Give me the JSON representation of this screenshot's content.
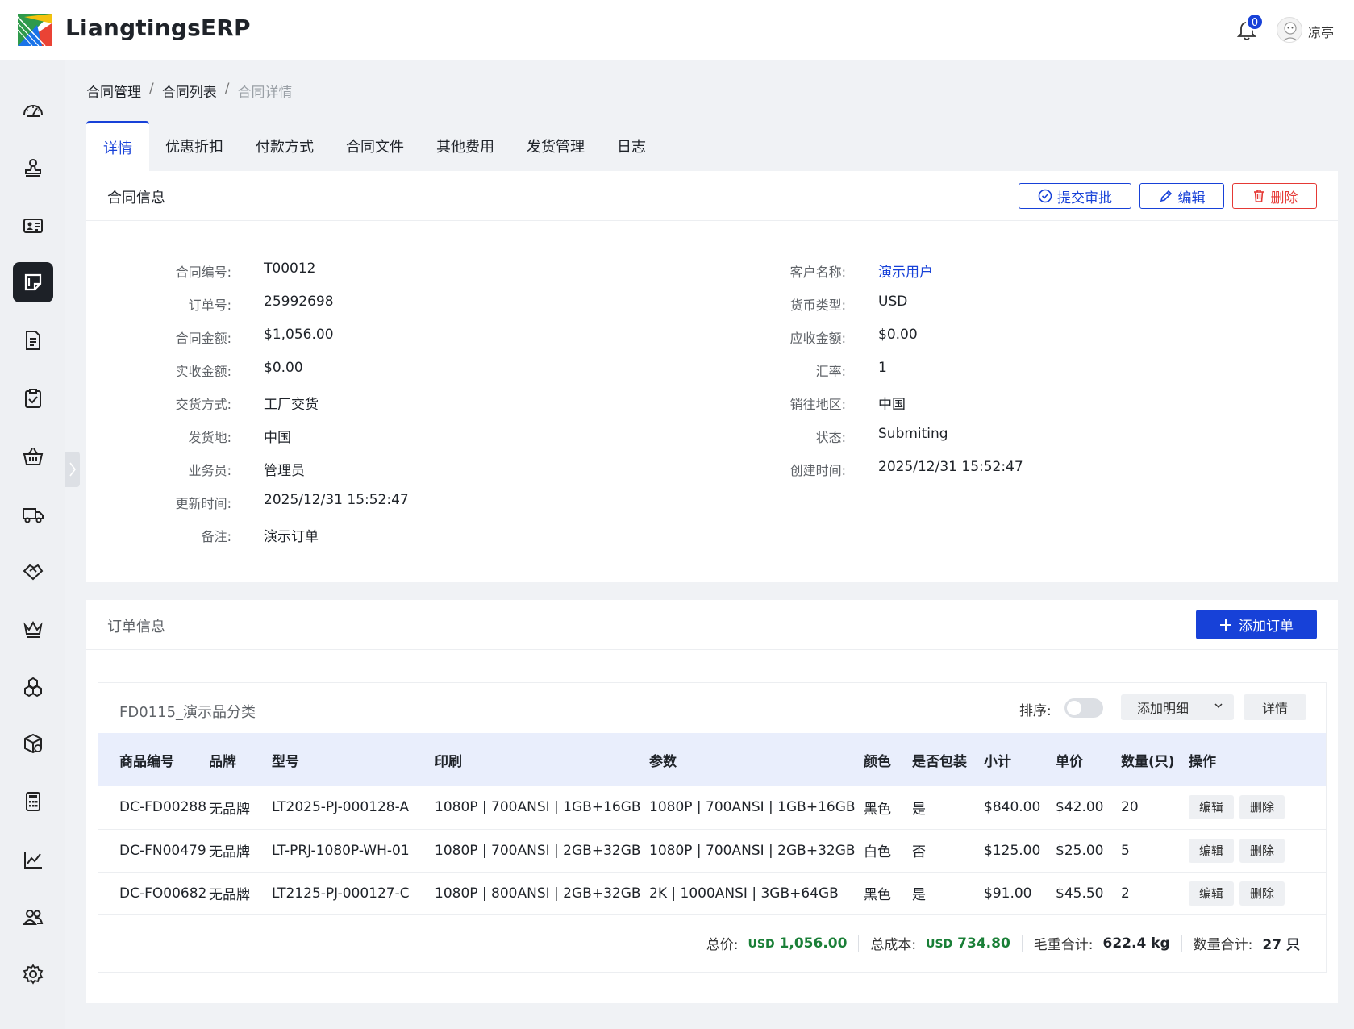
{
  "app": {
    "name": "LiangtingsERP",
    "notification_count": "0",
    "user_name": "凉亭"
  },
  "breadcrumb": [
    "合同管理",
    "合同列表",
    "合同详情"
  ],
  "tabs": [
    "详情",
    "优惠折扣",
    "付款方式",
    "合同文件",
    "其他费用",
    "发货管理",
    "日志"
  ],
  "contract_panel": {
    "title": "合同信息",
    "buttons": {
      "submit": "提交审批",
      "edit": "编辑",
      "delete": "删除"
    },
    "left_fields": [
      {
        "label": "合同编号:",
        "value": "T00012"
      },
      {
        "label": "订单号:",
        "value": "25992698"
      },
      {
        "label": "合同金额:",
        "value": "$1,056.00"
      },
      {
        "label": "实收金额:",
        "value": "$0.00"
      },
      {
        "label": "交货方式:",
        "value": "工厂交货"
      },
      {
        "label": "发货地:",
        "value": "中国"
      },
      {
        "label": "业务员:",
        "value": "管理员"
      },
      {
        "label": "更新时间:",
        "value": "2025/12/31 15:52:47"
      },
      {
        "label": "备注:",
        "value": "演示订单"
      }
    ],
    "right_fields": [
      {
        "label": "客户名称:",
        "value": "演示用户"
      },
      {
        "label": "货币类型:",
        "value": "USD"
      },
      {
        "label": "应收金额:",
        "value": "$0.00"
      },
      {
        "label": "汇率:",
        "value": "1"
      },
      {
        "label": "销往地区:",
        "value": "中国"
      },
      {
        "label": "状态:",
        "value": "Submiting"
      },
      {
        "label": "创建时间:",
        "value": "2025/12/31 15:52:47"
      }
    ]
  },
  "order_panel": {
    "title": "订单信息",
    "add_button": "添加订单",
    "group": {
      "name": "FD0115_演示品分类",
      "sort_label": "排序:",
      "add_detail": "添加明细",
      "detail_button": "详情",
      "columns": [
        "商品编号",
        "品牌",
        "型号",
        "印刷",
        "参数",
        "颜色",
        "是否包装",
        "小计",
        "单价",
        "数量(只)",
        "操作"
      ],
      "rows": [
        {
          "code": "DC-FD00288",
          "brand": "无品牌",
          "model": "LT2025-PJ-000128-A",
          "print": "1080P | 700ANSI | 1GB+16GB",
          "params": "1080P | 700ANSI | 1GB+16GB",
          "color": "黑色",
          "packed": "是",
          "subtotal": "$840.00",
          "unit_price": "$42.00",
          "qty": "20"
        },
        {
          "code": "DC-FN00479",
          "brand": "无品牌",
          "model": "LT-PRJ-1080P-WH-01",
          "print": "1080P | 700ANSI | 2GB+32GB",
          "params": "1080P | 700ANSI | 2GB+32GB",
          "color": "白色",
          "packed": "否",
          "subtotal": "$125.00",
          "unit_price": "$25.00",
          "qty": "5"
        },
        {
          "code": "DC-FO00682",
          "brand": "无品牌",
          "model": "LT2125-PJ-000127-C",
          "print": "1080P | 800ANSI | 2GB+32GB",
          "params": "2K | 1000ANSI | 3GB+64GB",
          "color": "黑色",
          "packed": "是",
          "subtotal": "$91.00",
          "unit_price": "$45.50",
          "qty": "2"
        }
      ],
      "row_actions": {
        "edit": "编辑",
        "delete": "删除"
      },
      "totals": {
        "total_price_label": "总价:",
        "total_price_currency": "USD",
        "total_price_value": "1,056.00",
        "total_cost_label": "总成本:",
        "total_cost_currency": "USD",
        "total_cost_value": "734.80",
        "gross_weight_label": "毛重合计:",
        "gross_weight_value": "622.4 kg",
        "qty_label": "数量合计:",
        "qty_value": "27 只"
      }
    }
  },
  "colors": {
    "primary": "#1741d8",
    "danger": "#e53935",
    "money": "#1a7f37",
    "sidebar_active": "#1d2127",
    "table_header": "#e9eefc"
  },
  "sidebar_icons": [
    "dashboard-icon",
    "stamp-icon",
    "id-card-icon",
    "contract-icon",
    "document-icon",
    "clipboard-check-icon",
    "basket-icon",
    "truck-icon",
    "handshake-icon",
    "crown-icon",
    "cubes-icon",
    "package-icon",
    "calculator-icon",
    "line-chart-icon",
    "users-icon",
    "gear-icon"
  ]
}
